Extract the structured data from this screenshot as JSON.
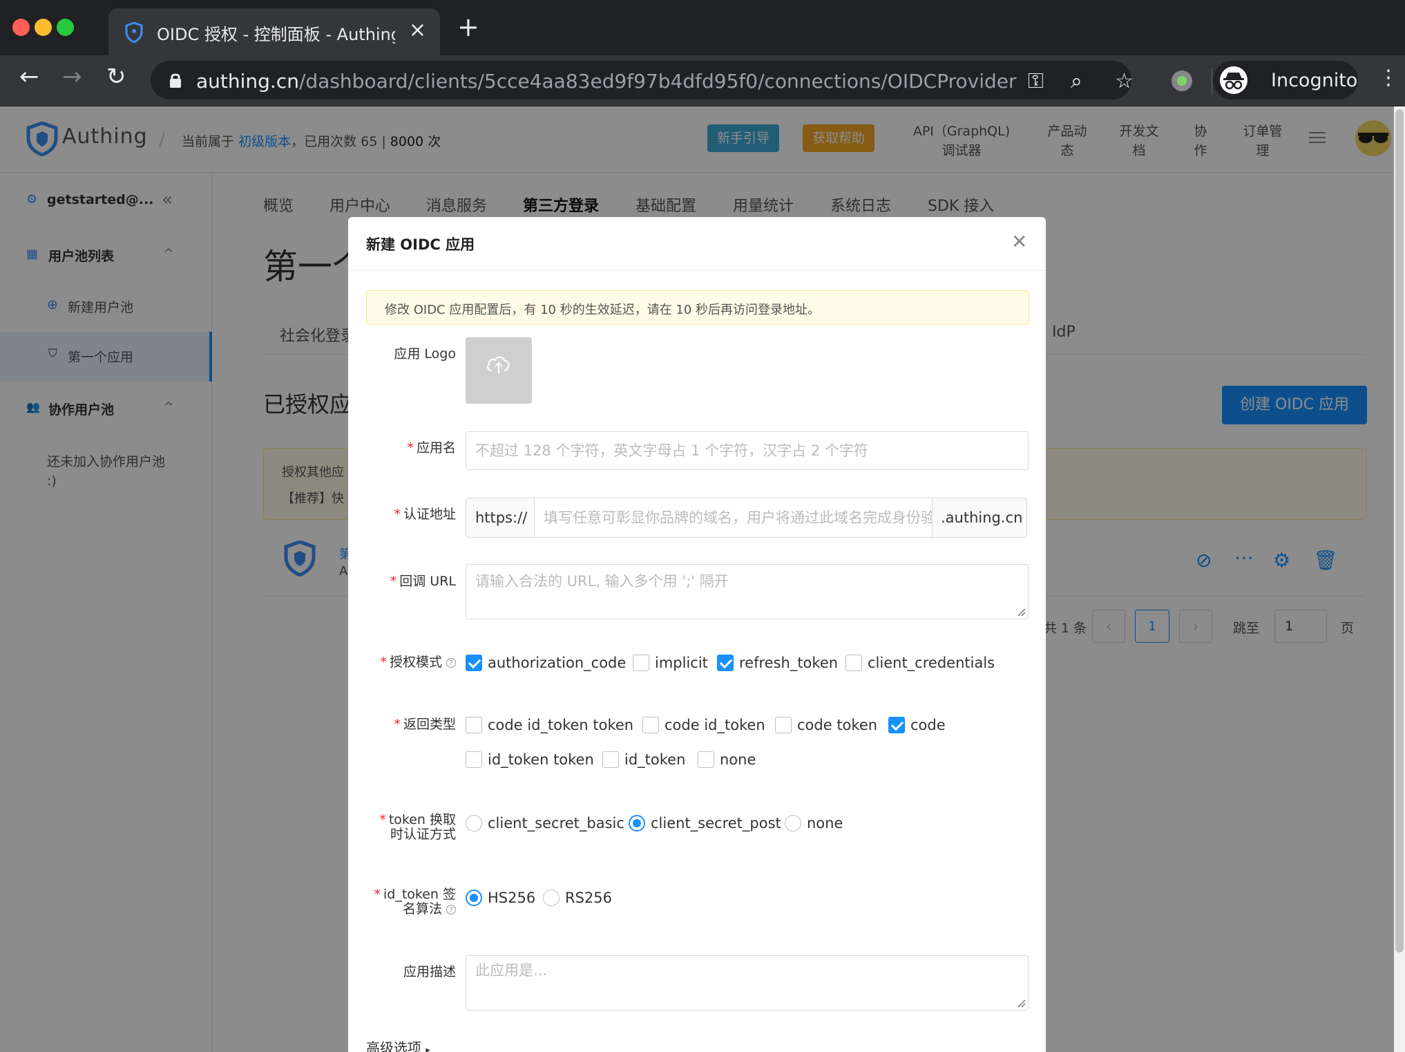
{
  "browser": {
    "tab_title": "OIDC 授权 - 控制面板 - Authing",
    "url_host": "authing.cn",
    "url_path": "/dashboard/clients/5cce4aa83ed9f97b4dfd95f0/connections/OIDCProvider",
    "profile_label": "Incognito"
  },
  "header": {
    "logo": "Authing",
    "plan_prefix": "当前属于",
    "plan_link": "初级版本",
    "usage_label": "，已用次数 65 |",
    "usage_limit": "8000 次",
    "btn_guide": "新手引导",
    "btn_help": "获取帮助",
    "links": [
      {
        "line1": "API（GraphQL)",
        "line2": "调试器"
      },
      {
        "line1": "产品动",
        "line2": "态"
      },
      {
        "line1": "开发文",
        "line2": "档"
      },
      {
        "line1": "协",
        "line2": "作"
      },
      {
        "line1": "订单管",
        "line2": "理"
      }
    ],
    "colors": {
      "guide": "#3fa9d8",
      "help": "#f5a623",
      "accent": "#1890ff"
    }
  },
  "sidebar": {
    "account": "getstarted@...",
    "pool_list": "用户池列表",
    "new_pool": "新建用户池",
    "first_app": "第一个应用",
    "collab_pool": "协作用户池",
    "collab_empty_1": "还未加入协作用户池",
    "collab_empty_2": ":)"
  },
  "main": {
    "tabs": [
      "概览",
      "用户中心",
      "消息服务",
      "第三方登录",
      "基础配置",
      "用量统计",
      "系统日志",
      "SDK 接入"
    ],
    "active_tab": "第三方登录",
    "page_title": "第一个",
    "subtab": "社会化登录",
    "subtab_right": "IdP",
    "section_title": "已授权应",
    "create_btn": "创建 OIDC 应用",
    "notice_1": "授权其他应",
    "notice_2": "【推荐】快",
    "row_partial_1": "第",
    "row_partial_2": "A",
    "pagination": {
      "total": "共 1 条",
      "current": "1",
      "jump_label": "跳至",
      "jump_value": "1",
      "page_suffix": "页"
    }
  },
  "modal": {
    "title": "新建 OIDC 应用",
    "alert": "修改 OIDC 应用配置后，有 10 秒的生效延迟，请在 10 秒后再访问登录地址。",
    "logo_label": "应用 Logo",
    "name_label": "应用名",
    "name_placeholder": "不超过 128 个字符，英文字母占 1 个字符，汉字占 2 个字符",
    "domain_label": "认证地址",
    "domain_prefix": "https://",
    "domain_placeholder": "填写任意可彰显你品牌的域名，用户将通过此域名完成身份验证",
    "domain_suffix": ".authing.cn",
    "callback_label": "回调 URL",
    "callback_placeholder": "请输入合法的 URL, 输入多个用 ';' 隔开",
    "grant_label": "授权模式",
    "grant_types": [
      {
        "label": "authorization_code",
        "checked": true
      },
      {
        "label": "implicit",
        "checked": false
      },
      {
        "label": "refresh_token",
        "checked": true
      },
      {
        "label": "client_credentials",
        "checked": false
      }
    ],
    "response_label": "返回类型",
    "response_types": [
      {
        "label": "code id_token token",
        "checked": false
      },
      {
        "label": "code id_token",
        "checked": false
      },
      {
        "label": "code token",
        "checked": false
      },
      {
        "label": "code",
        "checked": true
      },
      {
        "label": "id_token token",
        "checked": false
      },
      {
        "label": "id_token",
        "checked": false
      },
      {
        "label": "none",
        "checked": false
      }
    ],
    "auth_method_label_1": "token 换取",
    "auth_method_label_2": "时认证方式",
    "auth_methods": [
      {
        "label": "client_secret_basic",
        "selected": false
      },
      {
        "label": "client_secret_post",
        "selected": true
      },
      {
        "label": "none",
        "selected": false
      }
    ],
    "sign_label_1": "id_token 签",
    "sign_label_2": "名算法",
    "sign_algs": [
      {
        "label": "HS256",
        "selected": true
      },
      {
        "label": "RS256",
        "selected": false
      }
    ],
    "desc_label": "应用描述",
    "desc_placeholder": "此应用是...",
    "advanced": "高级选项"
  }
}
